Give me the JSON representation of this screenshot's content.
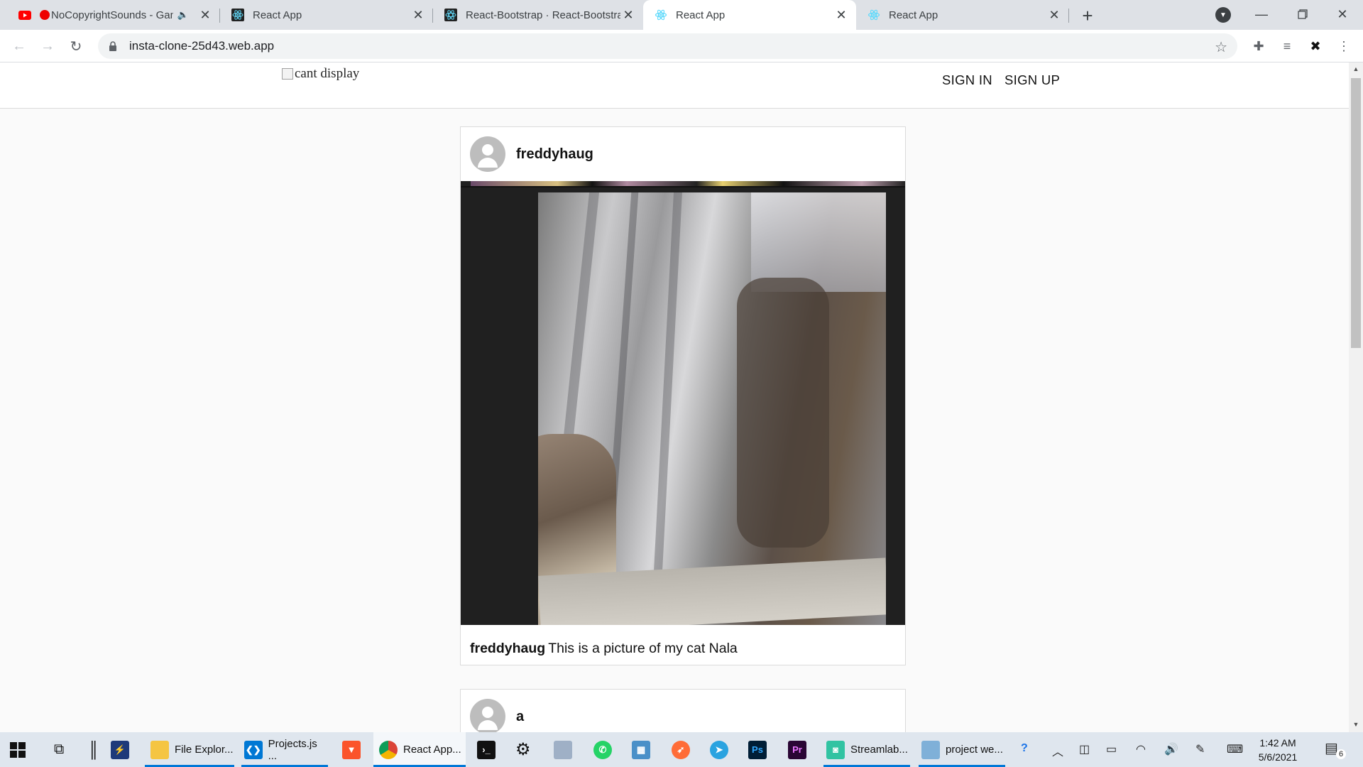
{
  "browser": {
    "tabs": [
      {
        "title": "NoCopyrightSounds - Gam",
        "icon": "youtube-icon",
        "audio": true
      },
      {
        "title": "React App",
        "icon": "react-icon"
      },
      {
        "title": "React-Bootstrap · React-Bootstrap",
        "icon": "react-bootstrap-icon"
      },
      {
        "title": "React App",
        "icon": "react-icon",
        "active": true
      },
      {
        "title": "React App",
        "icon": "react-icon"
      }
    ],
    "url": "insta-clone-25d43.web.app"
  },
  "app": {
    "logo_alt": "cant display",
    "sign_in": "SIGN IN",
    "sign_up": "SIGN UP",
    "posts": [
      {
        "username": "freddyhaug",
        "caption_user": "freddyhaug",
        "caption": "This is a picture of my cat Nala"
      },
      {
        "username": "a"
      }
    ]
  },
  "taskbar": {
    "items": [
      {
        "label": "File Explor...",
        "icon": "folder-icon"
      },
      {
        "label": "Projects.js ...",
        "icon": "vscode-icon"
      },
      {
        "label": "React App...",
        "icon": "chrome-icon"
      },
      {
        "label": "Streamlab...",
        "icon": "streamlabs-icon"
      },
      {
        "label": "project we...",
        "icon": "notepad-icon"
      }
    ],
    "time": "1:42 AM",
    "date": "5/6/2021",
    "notification_count": "6"
  }
}
